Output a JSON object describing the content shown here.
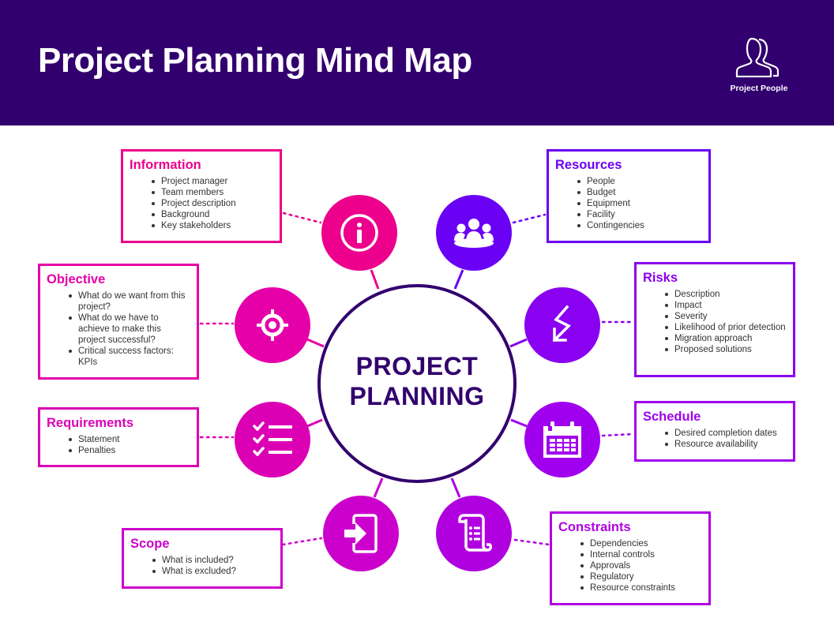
{
  "header": {
    "title": "Project Planning Mind Map",
    "logo_icon": "two-people-outline-icon",
    "logo_label": "Project People",
    "background_color": "#32006e"
  },
  "center": {
    "line1": "PROJECT",
    "line2": "PLANNING",
    "border_color": "#32006e"
  },
  "branches": [
    {
      "id": "information",
      "title": "Information",
      "icon": "info-icon",
      "color": "#ec008c",
      "items": [
        "Project manager",
        "Team members",
        "Project description",
        "Background",
        "Key stakeholders"
      ]
    },
    {
      "id": "resources",
      "title": "Resources",
      "icon": "group-icon",
      "color": "#6a00f4",
      "items": [
        "People",
        "Budget",
        "Equipment",
        "Facility",
        "Contingencies"
      ]
    },
    {
      "id": "objective",
      "title": "Objective",
      "icon": "target-icon",
      "color": "#e600a8",
      "items": [
        "What do we want from this project?",
        "What do we have to achieve to make this project successful?",
        "Critical success factors: KPIs"
      ]
    },
    {
      "id": "risks",
      "title": "Risks",
      "icon": "zigzag-arrow-icon",
      "color": "#8a00f0",
      "items": [
        "Description",
        "Impact",
        "Severity",
        "Likelihood of prior detection",
        "Migration approach",
        "Proposed solutions"
      ]
    },
    {
      "id": "requirements",
      "title": "Requirements",
      "icon": "checklist-icon",
      "color": "#dc00b4",
      "items": [
        "Statement",
        "Penalties"
      ]
    },
    {
      "id": "schedule",
      "title": "Schedule",
      "icon": "calendar-icon",
      "color": "#a000ee",
      "items": [
        "Desired completion dates",
        "Resource availability"
      ]
    },
    {
      "id": "scope",
      "title": "Scope",
      "icon": "enter-door-icon",
      "color": "#cc00cc",
      "items": [
        "What is included?",
        "What is excluded?"
      ]
    },
    {
      "id": "constraints",
      "title": "Constraints",
      "icon": "scroll-list-icon",
      "color": "#b000e0",
      "items": [
        "Dependencies",
        "Internal controls",
        "Approvals",
        "Regulatory",
        "Resource constraints"
      ]
    }
  ]
}
